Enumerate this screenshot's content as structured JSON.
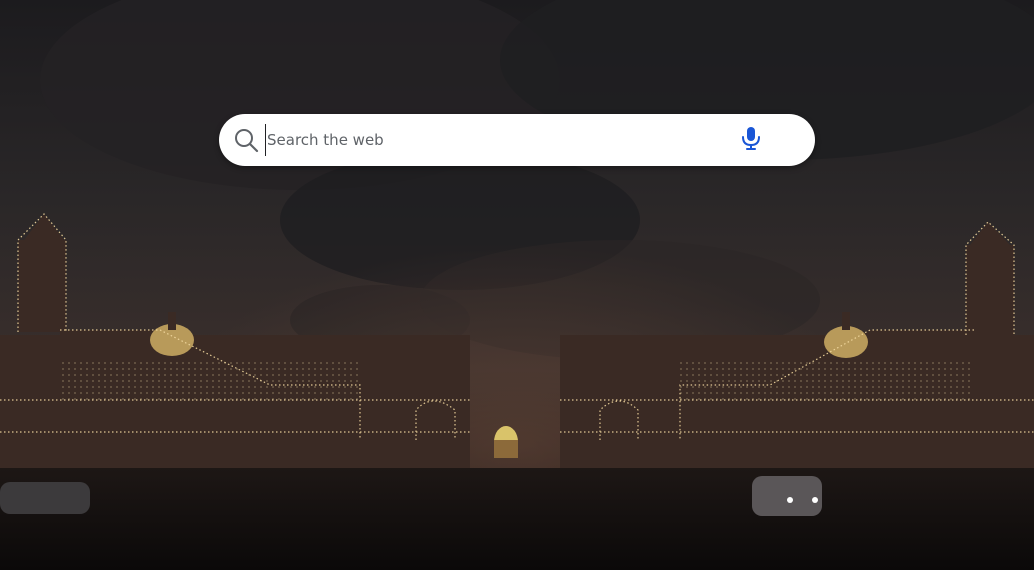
{
  "search": {
    "placeholder": "Search the web",
    "value": ""
  },
  "icons": {
    "search": "search-icon",
    "mic": "microphone-icon"
  },
  "colors": {
    "mic_accent": "#1a56d6",
    "search_icon": "#5f6368",
    "search_bg": "#ffffff",
    "lights": "#f3d9a0"
  }
}
